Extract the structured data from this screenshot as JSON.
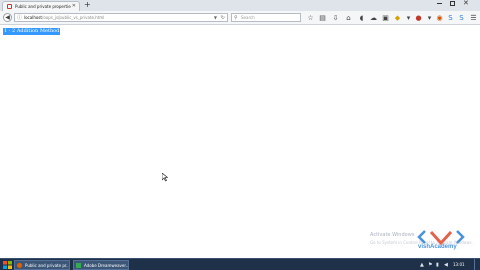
{
  "browser": {
    "tab": {
      "title": "Public and private properties ..."
    },
    "url": {
      "host": "localhost",
      "path": "/oops_js/public_vs_private.html"
    },
    "search": {
      "placeholder": "Search"
    }
  },
  "page": {
    "link_text": "1 - 2 Addition Method"
  },
  "watermark": {
    "line1": "Activate Windows",
    "line2": "Go to System in Control Panel to activate Windows.",
    "brand": "vishAcademy"
  },
  "taskbar": {
    "items": [
      {
        "label": "Public and private pr..."
      },
      {
        "label": "Adobe Dreamweaver..."
      }
    ],
    "clock": "13:01"
  }
}
